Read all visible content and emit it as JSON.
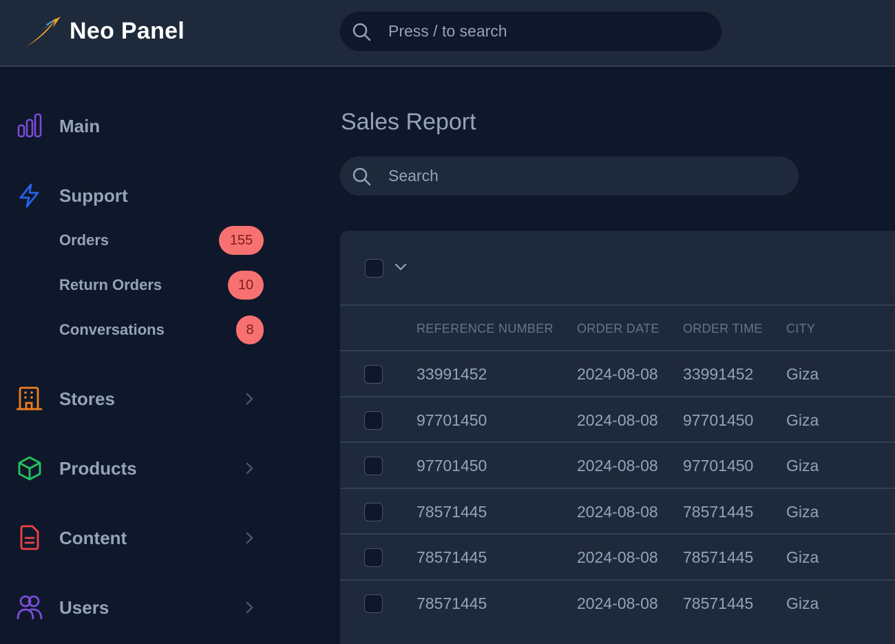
{
  "app": {
    "brand": "Neo Panel",
    "logo_icon": "rising-arrow-logo",
    "top_search_placeholder": "Press / to search"
  },
  "colors": {
    "logo_orange": "#f5a623",
    "logo_blue": "#4aa3d8",
    "badge_bg": "#f87171",
    "badge_text": "#7f1d1d",
    "icon_main": "#7c4ddb",
    "icon_support": "#2563eb",
    "icon_stores": "#f07f1f",
    "icon_products": "#22c55e",
    "icon_content": "#ef4444",
    "icon_users": "#7c4ddb"
  },
  "sidebar": {
    "items": [
      {
        "label": "Main",
        "icon": "bar-chart-icon",
        "has_chevron": false
      },
      {
        "label": "Support",
        "icon": "lightning-icon",
        "has_chevron": false
      },
      {
        "label": "Stores",
        "icon": "building-icon",
        "has_chevron": true
      },
      {
        "label": "Products",
        "icon": "cube-icon",
        "has_chevron": true
      },
      {
        "label": "Content",
        "icon": "document-icon",
        "has_chevron": true
      },
      {
        "label": "Users",
        "icon": "users-icon",
        "has_chevron": true
      }
    ],
    "support_sub": [
      {
        "label": "Orders",
        "badge": "155"
      },
      {
        "label": "Return Orders",
        "badge": "10"
      },
      {
        "label": "Conversations",
        "badge": "8"
      }
    ]
  },
  "main": {
    "title": "Sales Report",
    "search_placeholder": "Search",
    "table": {
      "columns": [
        "REFERENCE NUMBER",
        "ORDER DATE",
        "ORDER TIME",
        "CITY"
      ],
      "rows": [
        [
          "33991452",
          "2024-08-08",
          "33991452",
          "Giza"
        ],
        [
          "97701450",
          "2024-08-08",
          "97701450",
          "Giza"
        ],
        [
          "97701450",
          "2024-08-08",
          "97701450",
          "Giza"
        ],
        [
          "78571445",
          "2024-08-08",
          "78571445",
          "Giza"
        ],
        [
          "78571445",
          "2024-08-08",
          "78571445",
          "Giza"
        ],
        [
          "78571445",
          "2024-08-08",
          "78571445",
          "Giza"
        ]
      ]
    }
  }
}
